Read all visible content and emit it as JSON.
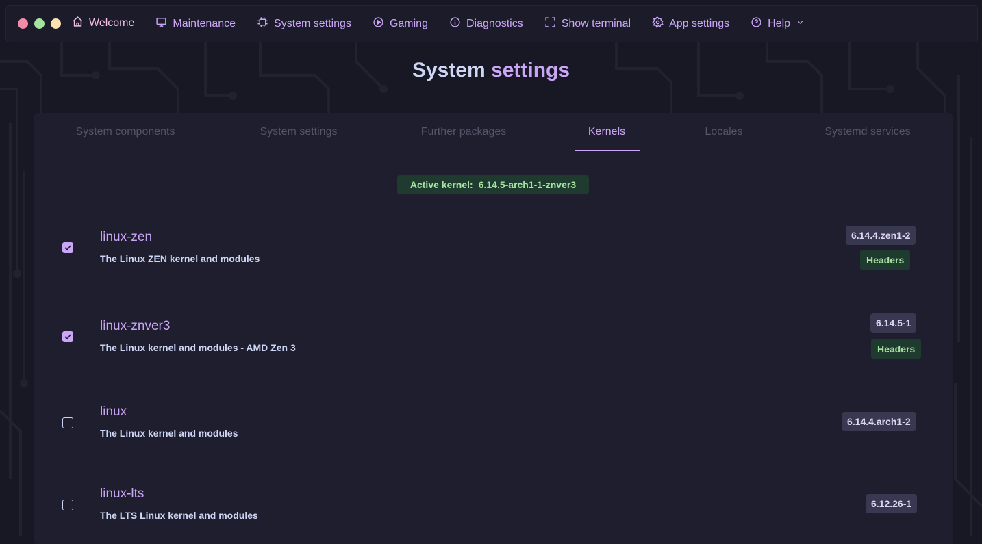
{
  "window": {
    "controls": [
      "close",
      "minimize",
      "maximize"
    ]
  },
  "nav": {
    "items": [
      {
        "label": "Welcome",
        "icon": "home-icon"
      },
      {
        "label": "Maintenance",
        "icon": "monitor-icon"
      },
      {
        "label": "System settings",
        "icon": "cpu-icon"
      },
      {
        "label": "Gaming",
        "icon": "play-circle-icon"
      },
      {
        "label": "Diagnostics",
        "icon": "info-circle-icon"
      },
      {
        "label": "Show terminal",
        "icon": "fullscreen-icon"
      },
      {
        "label": "App settings",
        "icon": "gear-icon"
      },
      {
        "label": "Help",
        "icon": "help-circle-icon"
      }
    ]
  },
  "page": {
    "title_part1": "System",
    "title_part2": "settings"
  },
  "tabs": [
    {
      "label": "System components",
      "active": false
    },
    {
      "label": "System settings",
      "active": false
    },
    {
      "label": "Further packages",
      "active": false
    },
    {
      "label": "Kernels",
      "active": true
    },
    {
      "label": "Locales",
      "active": false
    },
    {
      "label": "Systemd services",
      "active": false
    }
  ],
  "active_kernel": {
    "label": "Active kernel:",
    "value": "6.14.5-arch1-1-znver3"
  },
  "kernels": [
    {
      "name": "linux-zen",
      "description": "The Linux ZEN kernel and modules",
      "version": "6.14.4.zen1-2",
      "checked": true,
      "headers": "Headers"
    },
    {
      "name": "linux-znver3",
      "description": "The Linux kernel and modules - AMD Zen 3",
      "version": "6.14.5-1",
      "checked": true,
      "headers": "Headers"
    },
    {
      "name": "linux",
      "description": "The Linux kernel and modules",
      "version": "6.14.4.arch1-2",
      "checked": false,
      "headers": ""
    },
    {
      "name": "linux-lts",
      "description": "The LTS Linux kernel and modules",
      "version": "6.12.26-1",
      "checked": false,
      "headers": ""
    }
  ],
  "colors": {
    "background": "#181825",
    "accent": "#cba6f7",
    "green": "#a6e3a1",
    "text": "#cdd6f4"
  }
}
